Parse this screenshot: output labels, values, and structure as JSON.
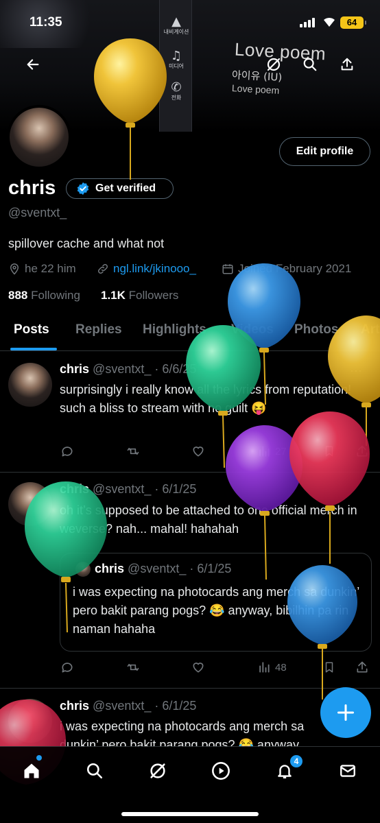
{
  "status_bar": {
    "time": "11:35",
    "battery": "64"
  },
  "banner": {
    "song_title": "Love poem",
    "artist": "아이유 (IU)",
    "song_sub": "Love poem",
    "side_items": [
      {
        "glyph": "▲",
        "label": "내비게이션"
      },
      {
        "glyph": "♫",
        "label": "미디어"
      },
      {
        "glyph": "✆",
        "label": "전화"
      }
    ]
  },
  "profile": {
    "display_name": "chris",
    "get_verified_label": "Get verified",
    "handle": "@sventxt_",
    "bio": "spillover cache and what not",
    "location": "he 22 him",
    "link": "ngl.link/jkinooo_",
    "joined": "Joined February 2021",
    "following_count": "888",
    "following_label": "Following",
    "followers_count": "1.1K",
    "followers_label": "Followers",
    "edit_profile_label": "Edit profile"
  },
  "tabs": [
    "Posts",
    "Replies",
    "Highlights",
    "Videos",
    "Photos",
    "Art"
  ],
  "posts": [
    {
      "name": "chris",
      "handle": "@sventxt_",
      "date": "· 6/6/25",
      "text": "surprisingly i really know all the lyrics from reputation! such a bliss to stream with no guilt 😝",
      "views": "27"
    },
    {
      "name": "chris",
      "handle": "@sventxt_",
      "date": "· 6/1/25",
      "text": "oh it’s supposed to be attached to one official merch in weverse? nah... mahal! hahahah",
      "views": "48",
      "quote": {
        "name": "chris",
        "handle": "@sventxt_",
        "date": "· 6/1/25",
        "text": "i was expecting na photocards ang merch sa dunkin’ pero bakit parang pogs? 😂 anyway, bibilhin pa rin naman hahaha"
      }
    },
    {
      "name": "chris",
      "handle": "@sventxt_",
      "date": "· 6/1/25",
      "text": "i was expecting na photocards ang merch sa dunkin’ pero bakit parang pogs? 😂 anyway"
    }
  ],
  "nav": {
    "notifications_badge": "4"
  },
  "colors": {
    "accent": "#1d9bf0",
    "background": "#000000",
    "muted": "#71767b"
  },
  "balloons": [
    "yellow",
    "blue",
    "green",
    "purple",
    "red",
    "yellow",
    "green",
    "blue",
    "red"
  ]
}
